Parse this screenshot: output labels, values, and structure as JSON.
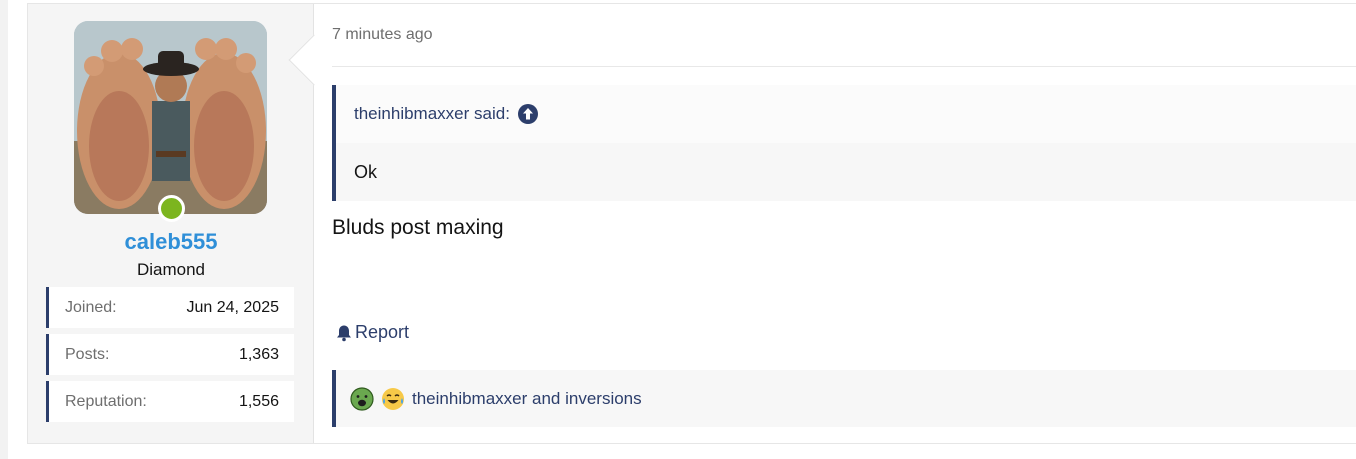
{
  "user": {
    "username": "caleb555",
    "title": "Diamond",
    "online": true,
    "stats": [
      {
        "label": "Joined:",
        "value": "Jun 24, 2025"
      },
      {
        "label": "Posts:",
        "value": "1,363"
      },
      {
        "label": "Reputation:",
        "value": "1,556"
      }
    ]
  },
  "post": {
    "timestamp": "7 minutes ago",
    "quote": {
      "author_line": "theinhibmaxxer said:",
      "body": "Ok"
    },
    "message": "Bluds post maxing",
    "report_label": "Report",
    "reactions": {
      "icons": [
        "sick-face-emoji-icon",
        "crying-laughing-emoji-icon"
      ],
      "text": "theinhibmaxxer and inversions"
    }
  },
  "colors": {
    "accent": "#2c3e6b",
    "username": "#2f8fd8",
    "online": "#7cb51f"
  }
}
